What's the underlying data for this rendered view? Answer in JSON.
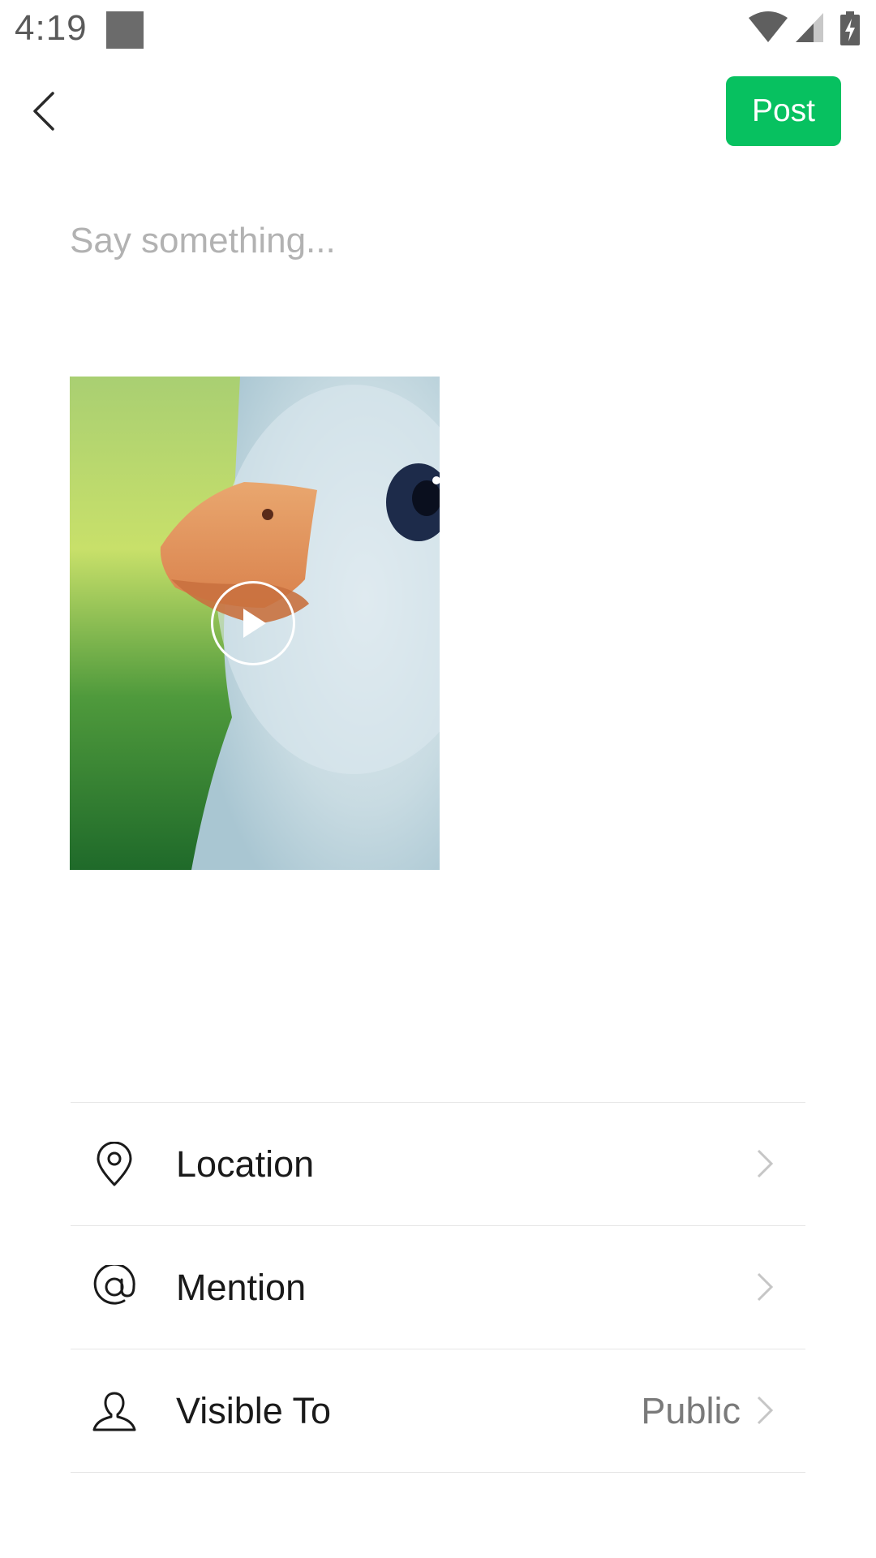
{
  "status_bar": {
    "time": "4:19",
    "icons": [
      "notification-square-icon",
      "wifi-icon",
      "signal-icon",
      "battery-charging-icon"
    ]
  },
  "header": {
    "back_icon": "chevron-left-icon",
    "post_label": "Post"
  },
  "composer": {
    "placeholder": "Say something...",
    "value": ""
  },
  "media": {
    "type": "video",
    "play_icon": "play-icon"
  },
  "options": [
    {
      "icon": "location-pin-icon",
      "label": "Location",
      "value": ""
    },
    {
      "icon": "at-sign-icon",
      "label": "Mention",
      "value": ""
    },
    {
      "icon": "person-icon",
      "label": "Visible To",
      "value": "Public"
    }
  ],
  "colors": {
    "accent": "#07c160",
    "placeholder": "#b2b2b2",
    "divider": "#e6e6e6",
    "secondary_text": "#7a7a7a"
  }
}
